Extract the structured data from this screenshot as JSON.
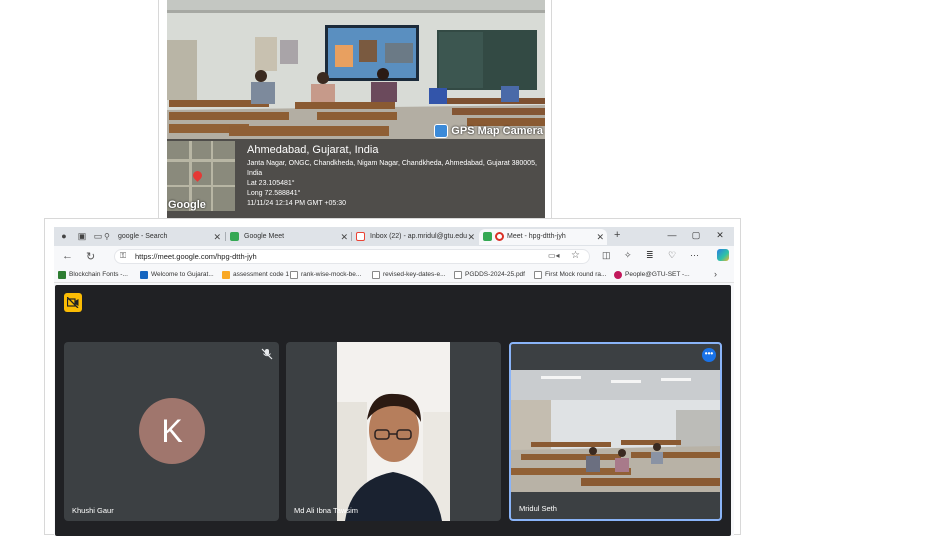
{
  "photo": {
    "badge": "GPS Map Camera",
    "city": "Ahmedabad, Gujarat, India",
    "address": "Janta Nagar, ONGC, Chandkheda, Nigam Nagar, Chandkheda, Ahmedabad, Gujarat 380005,",
    "address2": "India",
    "lat": "Lat 23.105481°",
    "long": "Long 72.588841°",
    "datetime": "11/11/24 12:14 PM GMT +05:30",
    "map_logo": "Google"
  },
  "browser": {
    "tabs": [
      {
        "label": "google - Search",
        "icon": "search-icon"
      },
      {
        "label": "Google Meet",
        "icon": "meet-icon"
      },
      {
        "label": "Inbox (22) - ap.mridul@gtu.edu",
        "icon": "gmail-icon"
      },
      {
        "label": "Meet - hpg-dtth-jyh",
        "icon": "meet-icon"
      }
    ],
    "url": "https://meet.google.com/hpg-dtth-jyh",
    "bookmarks": [
      {
        "label": "Blockchain Fonts -...",
        "color": "#2e7d32"
      },
      {
        "label": "Welcome to Gujarat...",
        "color": "#1565c0"
      },
      {
        "label": "assessment code 1",
        "color": "#f9a825"
      },
      {
        "label": "rank-wise-mock-be...",
        "color": "#616161"
      },
      {
        "label": "revised-key-dates-e...",
        "color": "#616161"
      },
      {
        "label": "PGDDS-2024-25.pdf",
        "color": "#616161"
      },
      {
        "label": "First Mock round ra...",
        "color": "#616161"
      },
      {
        "label": "People@GTU-SET -...",
        "color": "#c2185b"
      }
    ]
  },
  "meet": {
    "participants": [
      {
        "name": "Khushi Gaur",
        "initial": "K"
      },
      {
        "name": "Md Ali Ibna Tawsim"
      },
      {
        "name": "Mridul Seth"
      }
    ],
    "more_label": "•••"
  }
}
